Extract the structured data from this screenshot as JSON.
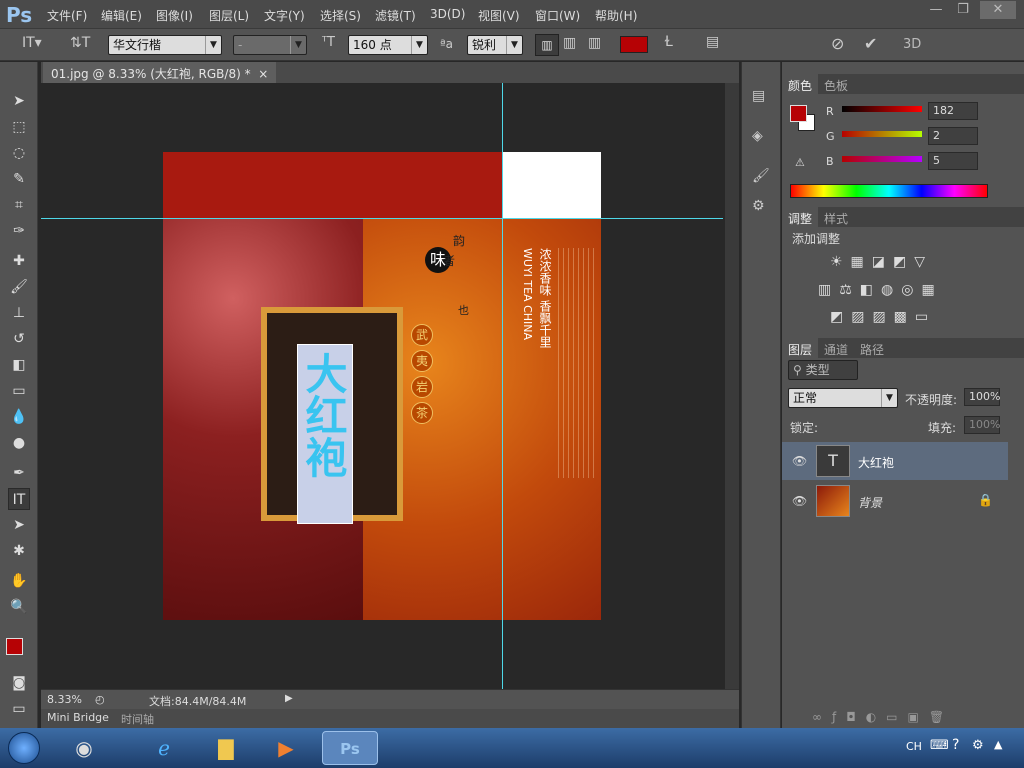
{
  "app": {
    "logo": "Ps"
  },
  "menu": [
    "文件(F)",
    "编辑(E)",
    "图像(I)",
    "图层(L)",
    "文字(Y)",
    "选择(S)",
    "滤镜(T)",
    "3D(D)",
    "视图(V)",
    "窗口(W)",
    "帮助(H)"
  ],
  "window_controls": {
    "minimize": "—",
    "restore": "❐",
    "close": "✕"
  },
  "options": {
    "font_family": "华文行楷",
    "font_style": "-",
    "font_size": "160 点",
    "antialias_label": "ªa",
    "antialias": "锐利",
    "text_color": "#b60205",
    "label_3d": "3D"
  },
  "document": {
    "tab_title": "01.jpg @ 8.33% (大红袍, RGB/8) *",
    "close": "×",
    "artwork": {
      "big_text": "大红袍",
      "vertical_cn_1": "浓浓香味  香飘千里",
      "vertical_en": "WUYI TEA CHINA",
      "seal": "味",
      "poem_right": "韵",
      "poem_left": "者",
      "poem_bottom": "也",
      "circles": [
        "武",
        "夷",
        "岩",
        "茶"
      ]
    }
  },
  "status": {
    "zoom": "8.33%",
    "doc": "文档:84.4M/84.4M"
  },
  "bottom_tabs": [
    "Mini Bridge",
    "时间轴"
  ],
  "color_panel": {
    "tabs": [
      "颜色",
      "色板"
    ],
    "r_label": "R",
    "r": "182",
    "g_label": "G",
    "g": "2",
    "b_label": "B",
    "b": "5",
    "fg": "#b60205",
    "bg": "#ffffff"
  },
  "adjust_panel": {
    "tabs": [
      "调整",
      "样式"
    ],
    "title": "添加调整"
  },
  "layers_panel": {
    "tabs": [
      "图层",
      "通道",
      "路径"
    ],
    "filter": "类型",
    "blend": "正常",
    "opacity_label": "不透明度:",
    "opacity": "100%",
    "lock_label": "锁定:",
    "fill_label": "填充:",
    "fill": "100%",
    "layers": [
      {
        "name": "大红袍",
        "thumb": "T"
      },
      {
        "name": "背景"
      }
    ]
  },
  "taskbar": {
    "lang": "CH"
  }
}
